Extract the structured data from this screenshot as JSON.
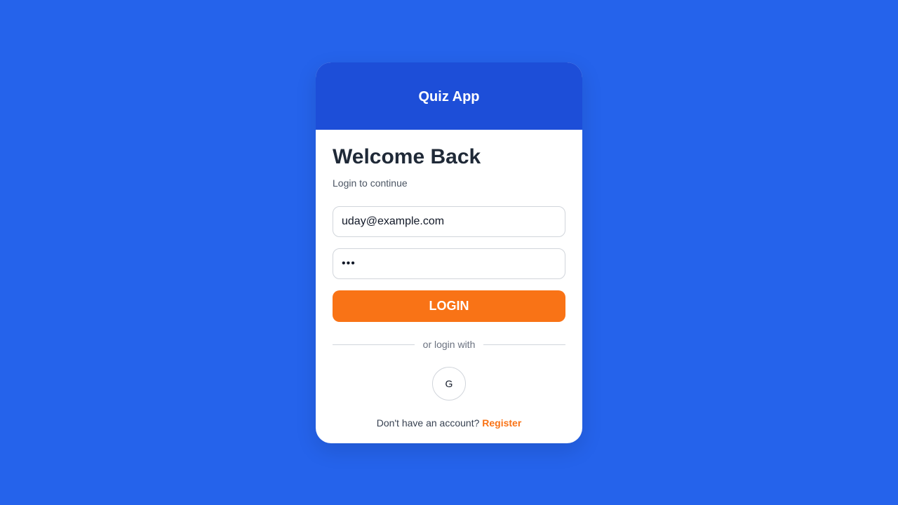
{
  "header": {
    "app_title": "Quiz App"
  },
  "login": {
    "title": "Welcome Back",
    "subtitle": "Login to continue",
    "email_value": "uday@example.com",
    "password_value": "•••",
    "submit_label": "LOGIN",
    "divider_text": "or login with",
    "google_label": "G",
    "no_account_text": "Don't have an account?",
    "register_label": "Register"
  },
  "colors": {
    "background": "#2563eb",
    "header": "#1d4ed8",
    "accent": "#f97316"
  }
}
